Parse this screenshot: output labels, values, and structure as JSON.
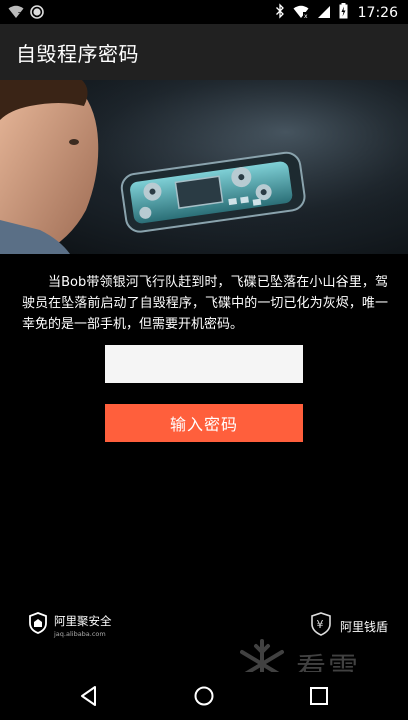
{
  "status_bar": {
    "time": "17:26",
    "icons": [
      "wifi-question-icon",
      "circle-icon",
      "bluetooth-icon",
      "wifi-icon",
      "signal-icon",
      "battery-charging-icon"
    ]
  },
  "app_bar": {
    "title": "自毁程序密码"
  },
  "banner": {
    "image": "man-and-phone-circuit-illustration"
  },
  "story": {
    "text": "当Bob带领银河飞行队赶到时，飞碟已坠落在小山谷里，驾驶员在坠落前启动了自毁程序，飞碟中的一切已化为灰烬，唯一幸免的是一部手机，但需要开机密码。"
  },
  "password": {
    "value": "",
    "placeholder": ""
  },
  "submit_button": {
    "label": "输入密码",
    "color": "#ff5f3c"
  },
  "brands": {
    "left": {
      "name": "阿里聚安全",
      "sub": "jaq.alibaba.com",
      "icon": "shield-logo-icon"
    },
    "right": {
      "name": "阿里钱盾",
      "icon": "yen-shield-icon"
    }
  },
  "watermark": {
    "text": "看雪",
    "icon": "snowflake-icon"
  },
  "nav_bar": {
    "icons": [
      "back-icon",
      "home-icon",
      "recents-icon"
    ]
  }
}
